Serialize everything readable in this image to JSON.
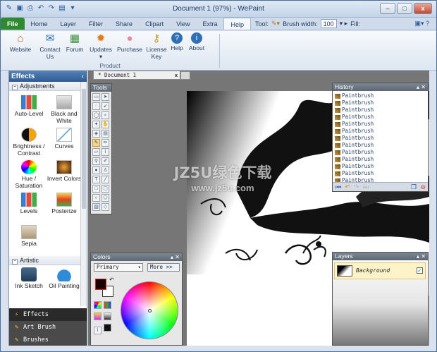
{
  "window": {
    "title": "Document 1 (97%) - WePaint",
    "min": "–",
    "restore": "□",
    "close": "x"
  },
  "menu": {
    "tabs": [
      "File",
      "Home",
      "Layer",
      "Filter",
      "Share",
      "Clipart",
      "View",
      "Extra",
      "Help"
    ],
    "tool_label": "Tool:",
    "brush_width_label": "Brush width:",
    "brush_width": "100",
    "fill_label": "Fill:"
  },
  "ribbon": {
    "buttons": [
      "Website",
      "Contact Us",
      "Forum",
      "Updates",
      "Purchase",
      "License Key",
      "Help",
      "About"
    ],
    "group": "Product"
  },
  "effects": {
    "title": "Effects",
    "chevron": "‹",
    "categories": [
      "Adjustments",
      "Artistic"
    ],
    "items": [
      "Auto-Level",
      "Black and White",
      "Brightness / Contrast",
      "Curves",
      "Hue / Saturation",
      "Invert Colors",
      "Levels",
      "Posterize",
      "Sepia",
      "Ink Sketch",
      "Oil Painting"
    ]
  },
  "nav": [
    "Effects",
    "Art Brush",
    "Brushes"
  ],
  "document": {
    "tab": "* Document 1",
    "close": "x"
  },
  "tools": {
    "title": "Tools"
  },
  "history": {
    "title": "History",
    "items": [
      "Paintbrush",
      "Paintbrush",
      "Paintbrush",
      "Paintbrush",
      "Paintbrush",
      "Paintbrush",
      "Paintbrush",
      "Paintbrush",
      "Paintbrush",
      "Paintbrush",
      "Paintbrush",
      "Paintbrush",
      "Paintbrush"
    ]
  },
  "colors": {
    "title": "Colors",
    "mode": "Primary",
    "more": "More >>",
    "primary": "#1a0000",
    "secondary": "#ffffff"
  },
  "layers": {
    "title": "Layers",
    "items": [
      "Background"
    ]
  },
  "watermark": {
    "line1": "JZ5U绿色下载",
    "line2": "www.jz5u.com"
  },
  "accent": {
    "ribbon": "#2f5c93",
    "file": "#2f8a2f"
  }
}
